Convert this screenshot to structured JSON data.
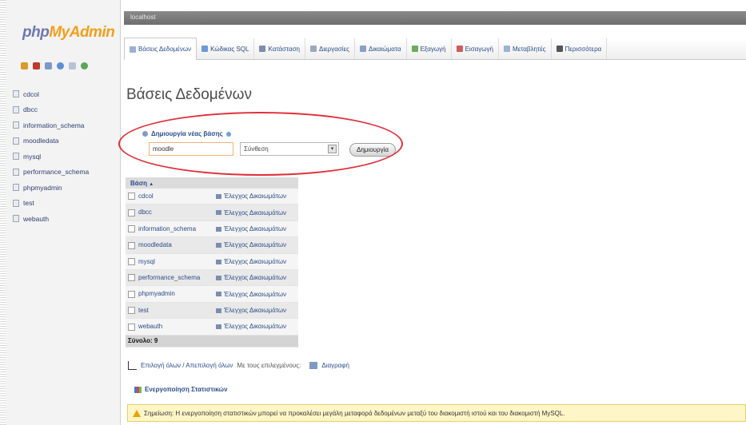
{
  "sidebar": {
    "logo_php": "php",
    "logo_myadmin": "MyAdmin",
    "icons": [
      "home-icon",
      "database-icon",
      "sql-icon",
      "help-icon",
      "docs-icon",
      "reload-icon"
    ],
    "databases": [
      "cdcol",
      "dbcc",
      "information_schema",
      "moodledata",
      "mysql",
      "performance_schema",
      "phpmyadmin",
      "test",
      "webauth"
    ]
  },
  "topbar": {
    "server": "localhost"
  },
  "tabs": [
    {
      "label": "Βάσεις Δεδομένων",
      "icon": "databases-icon",
      "color": "#9bb1d4",
      "active": true
    },
    {
      "label": "Κώδικας SQL",
      "icon": "sql-icon",
      "color": "#6d9ad6"
    },
    {
      "label": "Κατάσταση",
      "icon": "status-icon",
      "color": "#7c8ea8"
    },
    {
      "label": "Διεργασίες",
      "icon": "processes-icon",
      "color": "#9ea9b8"
    },
    {
      "label": "Δικαιώματα",
      "icon": "privileges-icon",
      "color": "#8aa0c4"
    },
    {
      "label": "Εξαγωγή",
      "icon": "export-icon",
      "color": "#6eaa5e"
    },
    {
      "label": "Εισαγωγή",
      "icon": "import-icon",
      "color": "#d05c5c"
    },
    {
      "label": "Μεταβλητές",
      "icon": "variables-icon",
      "color": "#9cb3d1"
    },
    {
      "label": "Περισσότερα",
      "icon": "more-icon",
      "color": "#555555"
    }
  ],
  "page": {
    "title": "Βάσεις Δεδομένων"
  },
  "create_db": {
    "label": "Δημιουργία νέας βάσης",
    "name_value": "moodle",
    "collation_value": "Σύνθεση",
    "button_label": "Δημιουργία"
  },
  "table": {
    "header": "Βάση",
    "sort_glyph": "▲",
    "rows": [
      {
        "name": "cdcol",
        "privileges": "Έλεγχος Δικαιωμάτων"
      },
      {
        "name": "dbcc",
        "privileges": "Έλεγχος Δικαιωμάτων"
      },
      {
        "name": "information_schema",
        "privileges": "Έλεγχος Δικαιωμάτων"
      },
      {
        "name": "moodledata",
        "privileges": "Έλεγχος Δικαιωμάτων"
      },
      {
        "name": "mysql",
        "privileges": "Έλεγχος Δικαιωμάτων"
      },
      {
        "name": "performance_schema",
        "privileges": "Έλεγχος Δικαιωμάτων"
      },
      {
        "name": "phpmyadmin",
        "privileges": "Έλεγχος Δικαιωμάτων"
      },
      {
        "name": "test",
        "privileges": "Έλεγχος Δικαιωμάτων"
      },
      {
        "name": "webauth",
        "privileges": "Έλεγχος Δικαιωμάτων"
      }
    ],
    "total": "Σύνολο: 9"
  },
  "selection": {
    "select_all": "Επιλογή όλων / Απεπιλογή όλων",
    "with_selected": "Με τους επιλεγμένους:",
    "drop": "Διαγραφή"
  },
  "stats": {
    "label": "Ενεργοποίηση Στατιστικών"
  },
  "notice": {
    "text": "Σημείωση: Η ενεργοποίηση στατιστικών μπορεί να προκαλέσει μεγάλη μεταφορά δεδομένων μεταξύ του διακομιστή ιστού και του διακομιστή MySQL."
  }
}
